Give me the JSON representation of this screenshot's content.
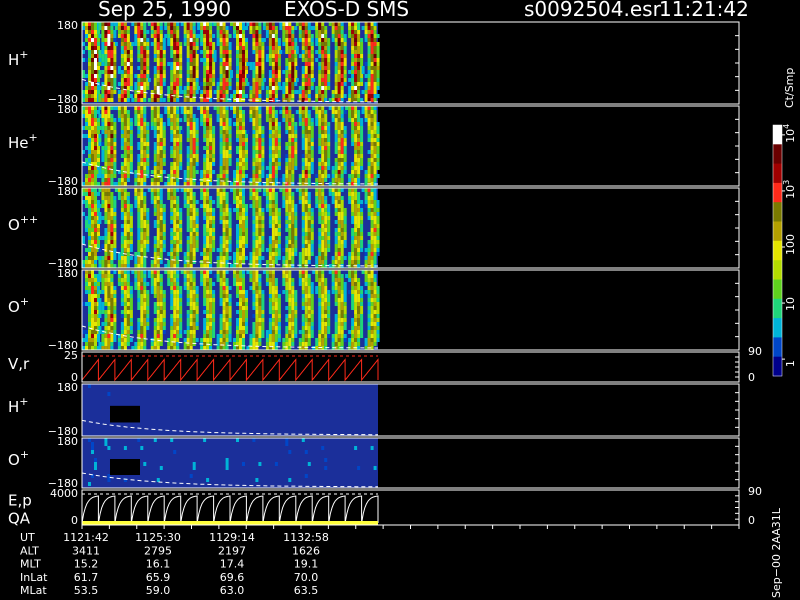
{
  "header": {
    "date": "Sep 25, 1990",
    "mission": "EXOS-D SMS",
    "file": "s0092504.esr",
    "time": "11:21:42"
  },
  "colors": {
    "background": "#000000",
    "axes": "#ffffff",
    "spectrogram_bg": "#1b2f9a",
    "no_data": "#000000",
    "vr_trace": "#ff2a1a",
    "ep_trace": "#ffffff",
    "qa_bar": "#ffff3a",
    "dashed_curve": "#ffffff"
  },
  "colorbar": {
    "label": "Ct/Smp",
    "ticks": [
      "1",
      "10",
      "100",
      "10",
      "10"
    ],
    "tick_exponents": [
      "",
      "",
      "",
      "3",
      "4"
    ],
    "tick_values": [
      1,
      10,
      100,
      1000,
      10000
    ],
    "range": [
      0.5,
      15000
    ],
    "scale": "log",
    "stops": [
      "#00008b",
      "#0046c8",
      "#00b4d8",
      "#1fd67a",
      "#5fd21e",
      "#b4dc00",
      "#e6e600",
      "#b4a000",
      "#7a7a00",
      "#ff2a1a",
      "#a00000",
      "#6a0000",
      "#ffffff"
    ]
  },
  "chart_data": {
    "type": "heatmap",
    "title": "Sep 25, 1990   EXOS-D SMS",
    "data_coverage": [
      0,
      0.4
    ],
    "panels": [
      {
        "id": "h-plus",
        "label": "H",
        "sup": "+",
        "ytick_top": "180",
        "ytick_bottom": "−180",
        "ylim": [
          -180,
          180
        ],
        "kind": "spectrogram",
        "intensity": 0.9,
        "gap_box": false
      },
      {
        "id": "he-plus",
        "label": "He",
        "sup": "+",
        "ytick_top": "180",
        "ytick_bottom": "−180",
        "ylim": [
          -180,
          180
        ],
        "kind": "spectrogram",
        "intensity": 0.7,
        "gap_box": false
      },
      {
        "id": "o-plus-plus",
        "label": "O",
        "sup": "++",
        "ytick_top": "180",
        "ytick_bottom": "−180",
        "ylim": [
          -180,
          180
        ],
        "kind": "spectrogram",
        "intensity": 0.65,
        "gap_box": false
      },
      {
        "id": "o-plus",
        "label": "O",
        "sup": "+",
        "ytick_top": "180",
        "ytick_bottom": "−180",
        "ylim": [
          -180,
          180
        ],
        "kind": "spectrogram",
        "intensity": 0.65,
        "gap_box": false,
        "right_tick": "90"
      },
      {
        "id": "vr",
        "label": "V,r",
        "sup": "",
        "ytick_top": "25",
        "ytick_bottom": "0",
        "ylim": [
          0,
          25
        ],
        "kind": "trace",
        "right_tick_bottom": "0"
      },
      {
        "id": "h-plus-2",
        "label": "H",
        "sup": "+",
        "ytick_top": "180",
        "ytick_bottom": "−180",
        "ylim": [
          -180,
          180
        ],
        "kind": "spectrogram",
        "intensity": 0.1,
        "gap_box": true
      },
      {
        "id": "o-plus-2",
        "label": "O",
        "sup": "+",
        "ytick_top": "180",
        "ytick_bottom": "−180",
        "ylim": [
          -180,
          180
        ],
        "kind": "spectrogram",
        "intensity": 0.12,
        "gap_box": true
      },
      {
        "id": "ep",
        "label": "E,p",
        "sup": "",
        "label2": "QA",
        "ytick_top": "4000",
        "ytick_bottom": "0",
        "ylim": [
          0,
          4000
        ],
        "kind": "trace",
        "right_tick": "90",
        "right_tick_bottom": "0"
      }
    ],
    "scans": 18,
    "footer": {
      "labels": [
        "UT",
        "ALT",
        "MLT",
        "InLat",
        "MLat"
      ],
      "columns": [
        [
          "1121:42",
          "3411",
          "15.2",
          "61.7",
          "53.5"
        ],
        [
          "1125:30",
          "2795",
          "16.1",
          "65.9",
          "59.0"
        ],
        [
          "1129:14",
          "2197",
          "17.4",
          "69.6",
          "63.0"
        ],
        [
          "1132:58",
          "1626",
          "19.1",
          "70.0",
          "63.5"
        ]
      ]
    },
    "side_label": "Sep−00  2AA31L"
  }
}
